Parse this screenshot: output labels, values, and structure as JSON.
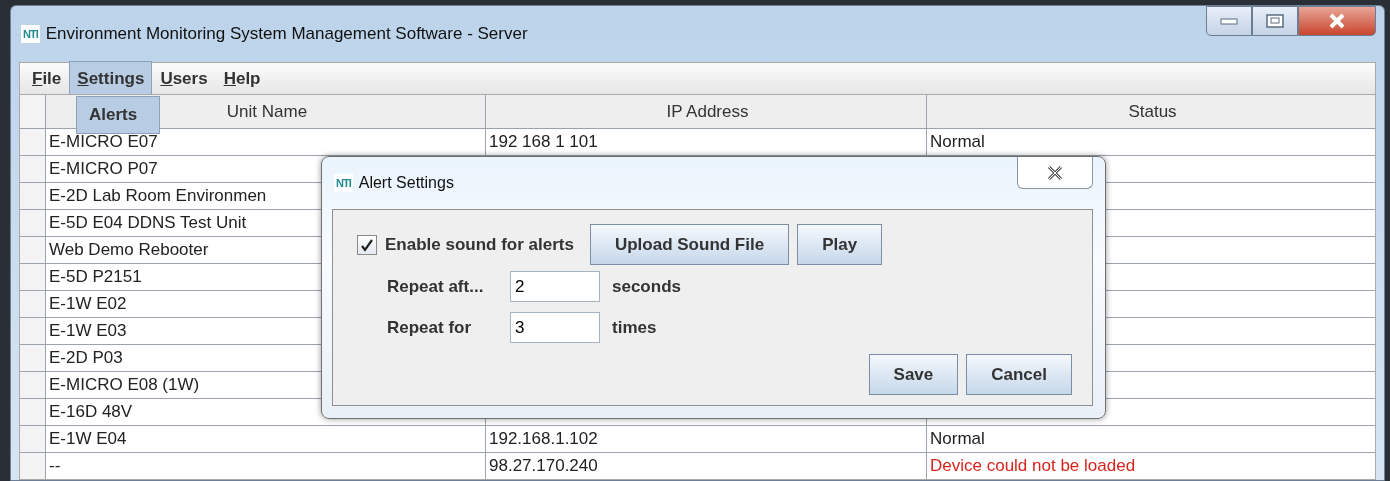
{
  "window": {
    "logo": "NTI",
    "title": "Environment Monitoring System Management Software - Server"
  },
  "menu": [
    {
      "label": "File",
      "selected": false
    },
    {
      "label": "Settings",
      "selected": true
    },
    {
      "label": "Users",
      "selected": false
    },
    {
      "label": "Help",
      "selected": false
    }
  ],
  "dropdown": {
    "items": [
      "Alerts"
    ]
  },
  "table": {
    "columns": [
      "Unit Name",
      "IP Address",
      "Status"
    ],
    "rows": [
      {
        "name": "E-MICRO E07",
        "ip": "192 168 1 101",
        "status": "Normal",
        "kind": "ok"
      },
      {
        "name": "E-MICRO P07"
      },
      {
        "name": "E-2D Lab Room Environmen"
      },
      {
        "name": "E-5D E04 DDNS Test Unit"
      },
      {
        "name": "Web Demo Rebooter"
      },
      {
        "name": "E-5D P2151"
      },
      {
        "name": "E-1W E02"
      },
      {
        "name": "E-1W E03"
      },
      {
        "name": "E-2D P03"
      },
      {
        "name": "E-MICRO E08 (1W)"
      },
      {
        "name": "E-16D 48V"
      },
      {
        "name": "E-1W E04",
        "ip": "192.168.1.102",
        "status": "Normal",
        "kind": "ok"
      },
      {
        "name": "--",
        "ip": "98.27.170.240",
        "status": "Device could not be loaded",
        "kind": "error"
      }
    ]
  },
  "dialog": {
    "logo": "NTI",
    "title": "Alert Settings",
    "enable_sound": {
      "label": "Enable sound for alerts",
      "checked": true
    },
    "buttons_top": [
      "Upload Sound File",
      "Play"
    ],
    "fields": [
      {
        "label": "Repeat aft...",
        "value": "2",
        "unit": "seconds"
      },
      {
        "label": "Repeat for",
        "value": "3",
        "unit": "times"
      }
    ],
    "buttons": [
      "Save",
      "Cancel"
    ]
  }
}
